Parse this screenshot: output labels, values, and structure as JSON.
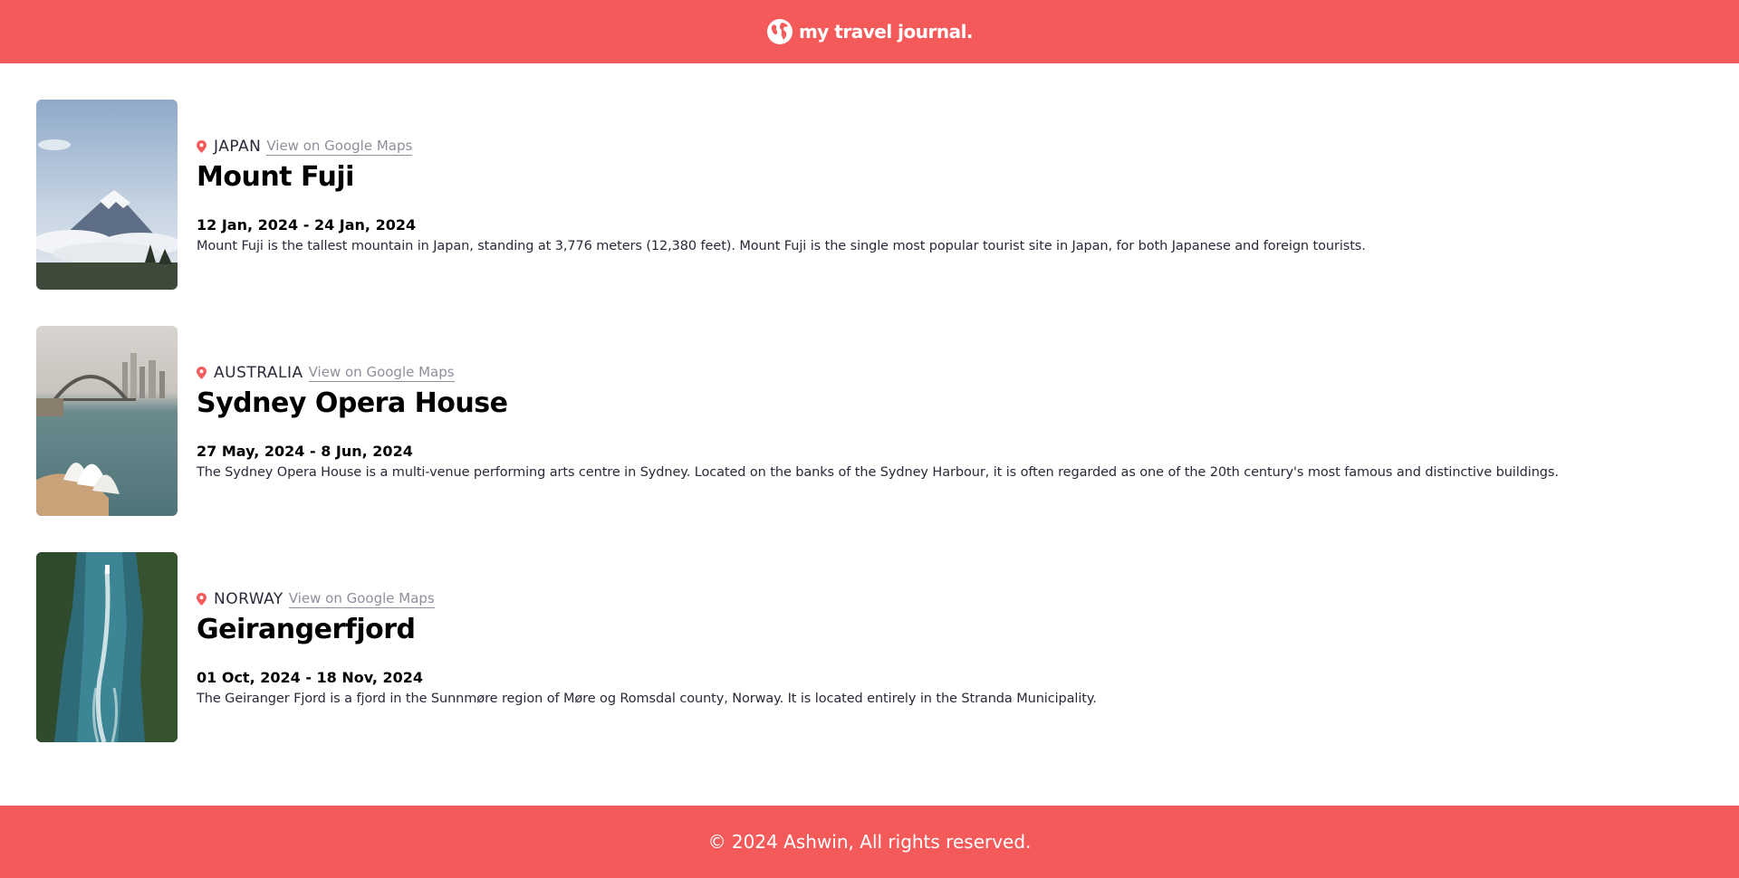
{
  "header": {
    "logo_icon": "globe-icon",
    "title": "my travel journal."
  },
  "entries": [
    {
      "country": "JAPAN",
      "maps_link": "View on Google Maps",
      "title": "Mount Fuji",
      "dates": "12 Jan, 2024 - 24 Jan, 2024",
      "description": "Mount Fuji is the tallest mountain in Japan, standing at 3,776 meters (12,380 feet). Mount Fuji is the single most popular tourist site in Japan, for both Japanese and foreign tourists."
    },
    {
      "country": "AUSTRALIA",
      "maps_link": "View on Google Maps",
      "title": "Sydney Opera House",
      "dates": "27 May, 2024 - 8 Jun, 2024",
      "description": "The Sydney Opera House is a multi-venue performing arts centre in Sydney. Located on the banks of the Sydney Harbour, it is often regarded as one of the 20th century's most famous and distinctive buildings."
    },
    {
      "country": "NORWAY",
      "maps_link": "View on Google Maps",
      "title": "Geirangerfjord",
      "dates": "01 Oct, 2024 - 18 Nov, 2024",
      "description": "The Geiranger Fjord is a fjord in the Sunnmøre region of Møre og Romsdal county, Norway. It is located entirely in the Stranda Municipality."
    }
  ],
  "footer": {
    "text": "© 2024 Ashwin, All rights reserved."
  },
  "colors": {
    "brand": "#F55A5A",
    "link": "#918E9B",
    "text": "#2B283A"
  },
  "icons": {
    "location": "location-pin-icon"
  }
}
